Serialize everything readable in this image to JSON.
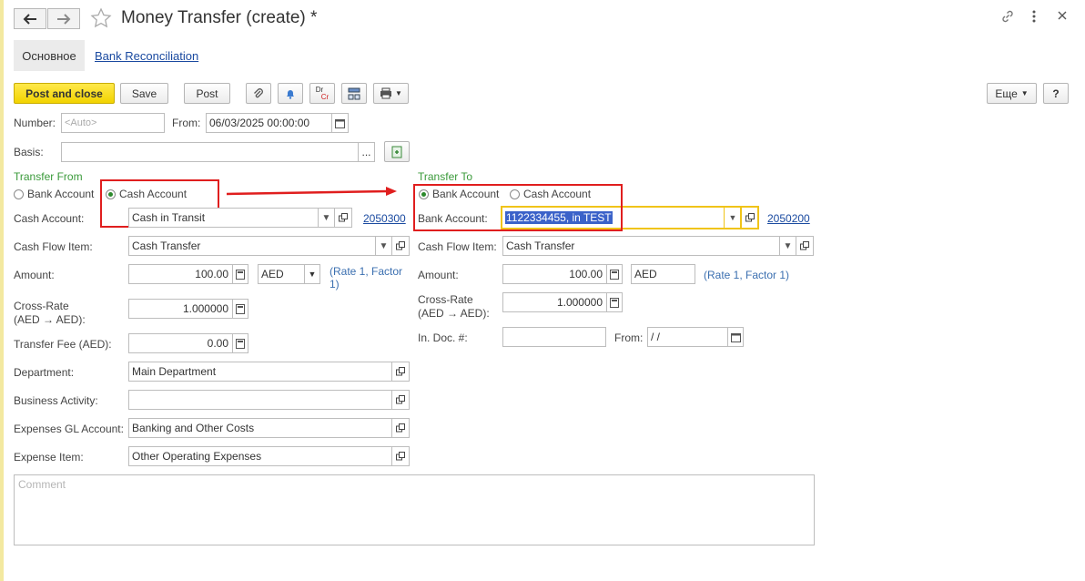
{
  "window": {
    "title": "Money Transfer (create) *",
    "back_icon": "arrow-left",
    "forward_icon": "arrow-right",
    "favorite_icon": "star",
    "link_icon": "link",
    "more_icon": "kebab",
    "close_icon": "close"
  },
  "tabs": [
    {
      "label": "Основное"
    },
    {
      "label": "Bank Reconciliation"
    }
  ],
  "toolbar": {
    "post_close": "Post and close",
    "save": "Save",
    "post": "Post",
    "more": "Еще",
    "help": "?",
    "dr_icon": "Dr",
    "cr_icon": "Cr"
  },
  "header": {
    "number_label": "Number:",
    "number_placeholder": "<Auto>",
    "from_label": "From:",
    "from_value": "06/03/2025 00:00:00",
    "basis_label": "Basis:",
    "basis_value": "",
    "ellipsis": "..."
  },
  "transfer_from": {
    "title": "Transfer From",
    "radio_bank": "Bank Account",
    "radio_cash": "Cash Account",
    "selected": "Cash Account",
    "cash_account_label": "Cash Account:",
    "cash_account_value": "Cash in Transit",
    "cash_account_code": "2050300",
    "cash_flow_label": "Cash Flow Item:",
    "cash_flow_value": "Cash Transfer",
    "amount_label": "Amount:",
    "amount_value": "100.00",
    "currency": "AED",
    "rate_text": "(Rate 1, Factor 1)",
    "cross_rate_label_1": "Cross-Rate",
    "cross_rate_label_2": "(AED → AED):",
    "cross_rate_value": "1.000000",
    "fee_label": "Transfer Fee (AED):",
    "fee_value": "0.00",
    "department_label": "Department:",
    "department_value": "Main Department",
    "business_label": "Business Activity:",
    "business_value": "",
    "gl_label": "Expenses GL Account:",
    "gl_value": "Banking and Other Costs",
    "expense_label": "Expense Item:",
    "expense_value": "Other Operating Expenses"
  },
  "transfer_to": {
    "title": "Transfer To",
    "radio_bank": "Bank Account",
    "radio_cash": "Cash Account",
    "selected": "Bank Account",
    "bank_account_label": "Bank Account:",
    "bank_account_value": "1122334455, in TEST",
    "bank_account_code": "2050200",
    "cash_flow_label": "Cash Flow Item:",
    "cash_flow_value": "Cash Transfer",
    "amount_label": "Amount:",
    "amount_value": "100.00",
    "currency": "AED",
    "rate_text": "(Rate 1, Factor 1)",
    "cross_rate_label_1": "Cross-Rate",
    "cross_rate_label_2": "(AED → AED):",
    "cross_rate_value": "1.000000",
    "in_doc_label": "In. Doc. #:",
    "in_doc_value": "",
    "from_label": "From:",
    "from_value": " /  /"
  },
  "comment": {
    "placeholder": "Comment"
  },
  "colors": {
    "highlight_box": "#e01e1e",
    "arrow": "#e01e1e",
    "primary_button": "#f2d300",
    "section_title": "#3a9a3a",
    "link": "#1a4aa0"
  }
}
